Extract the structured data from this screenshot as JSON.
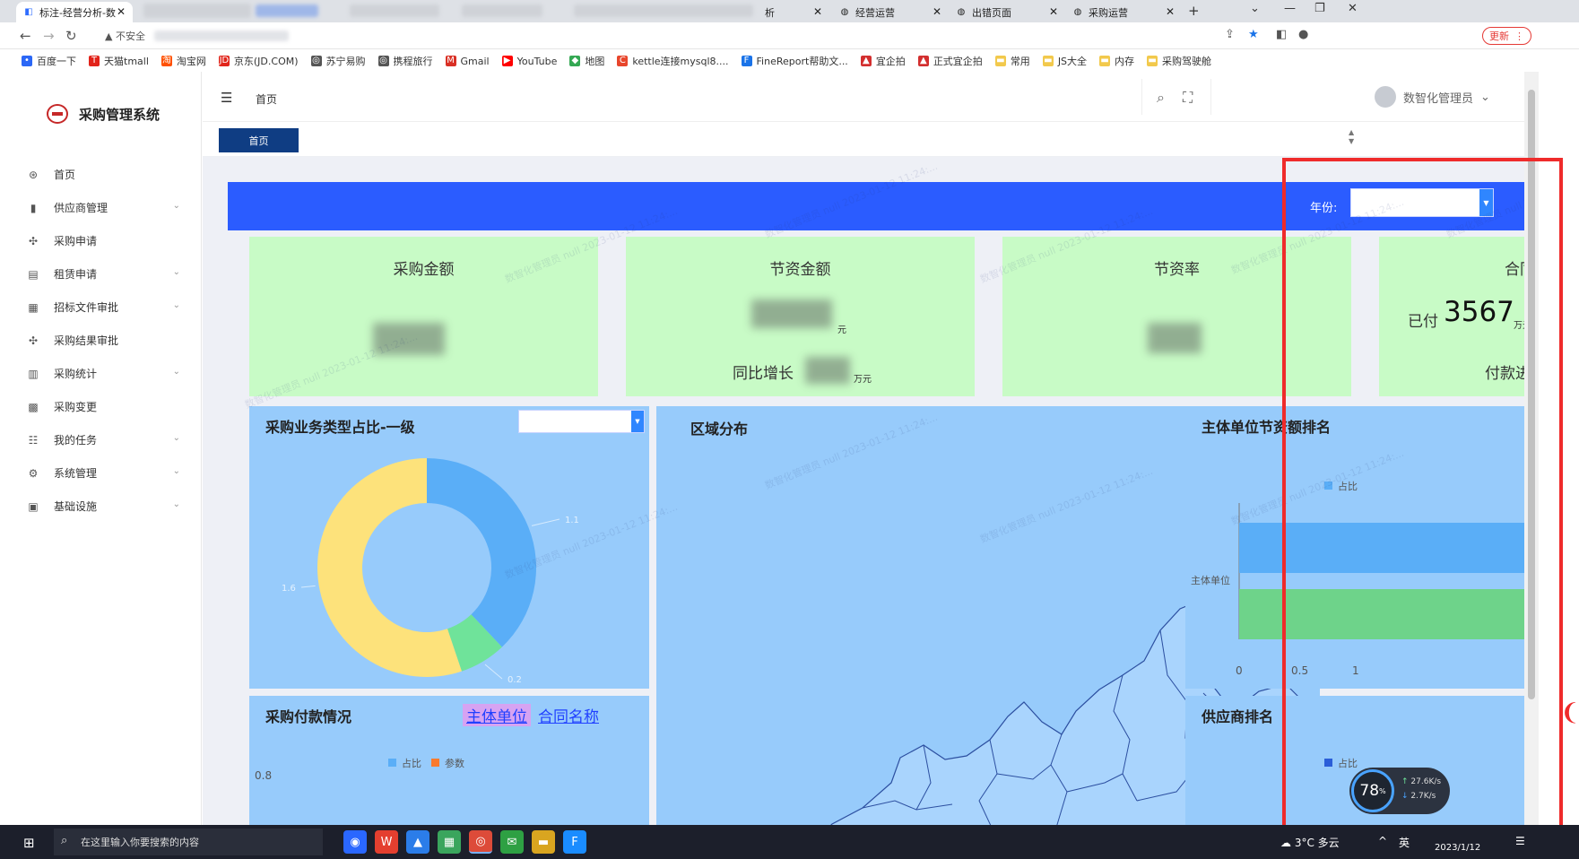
{
  "browser": {
    "tabs": [
      {
        "title": "标注-经营分析-数",
        "close": "✕"
      },
      {
        "title": "析",
        "close": "✕"
      },
      {
        "title": "经营运营",
        "close": "✕"
      },
      {
        "title": "出错页面",
        "close": "✕"
      },
      {
        "title": "采购运营",
        "close": "✕"
      }
    ],
    "new_tab": "+",
    "insecure_label": "不安全",
    "update_label": "更新",
    "bookmarks": [
      {
        "label": "百度一下",
        "color": "#2b67f6",
        "glyph": "•"
      },
      {
        "label": "天猫tmall",
        "color": "#e2231a",
        "glyph": "T"
      },
      {
        "label": "淘宝网",
        "color": "#ff5000",
        "glyph": "淘"
      },
      {
        "label": "京东(JD.COM)",
        "color": "#e1251b",
        "glyph": "JD"
      },
      {
        "label": "苏宁易购",
        "color": "#555555",
        "glyph": "◎"
      },
      {
        "label": "携程旅行",
        "color": "#555555",
        "glyph": "◎"
      },
      {
        "label": "Gmail",
        "color": "#d93025",
        "glyph": "M"
      },
      {
        "label": "YouTube",
        "color": "#ff0000",
        "glyph": "▶"
      },
      {
        "label": "地图",
        "color": "#34a853",
        "glyph": "◆"
      },
      {
        "label": "kettle连接mysql8....",
        "color": "#e8462c",
        "glyph": "C"
      },
      {
        "label": "FineReport帮助文...",
        "color": "#1a73e8",
        "glyph": "F"
      },
      {
        "label": "宜企拍",
        "color": "#d32f2f",
        "glyph": "▲"
      },
      {
        "label": "正式宜企拍",
        "color": "#d32f2f",
        "glyph": "▲"
      },
      {
        "label": "常用",
        "color": "#f2c94c",
        "glyph": "▬"
      },
      {
        "label": "JS大全",
        "color": "#f2c94c",
        "glyph": "▬"
      },
      {
        "label": "内存",
        "color": "#f2c94c",
        "glyph": "▬"
      },
      {
        "label": "采购驾驶舱",
        "color": "#f2c94c",
        "glyph": "▬"
      }
    ]
  },
  "app": {
    "name": "采购管理系统",
    "breadcrumb": "首页",
    "home_tag": "首页",
    "user_name": "数智化管理员",
    "menu": [
      {
        "label": "首页",
        "icon": "⊛",
        "has_children": false
      },
      {
        "label": "供应商管理",
        "icon": "▮",
        "has_children": true
      },
      {
        "label": "采购申请",
        "icon": "✣",
        "has_children": false
      },
      {
        "label": "租赁申请",
        "icon": "▤",
        "has_children": true
      },
      {
        "label": "招标文件审批",
        "icon": "▦",
        "has_children": true
      },
      {
        "label": "采购结果审批",
        "icon": "✣",
        "has_children": false
      },
      {
        "label": "采购统计",
        "icon": "▥",
        "has_children": true
      },
      {
        "label": "采购变更",
        "icon": "▩",
        "has_children": false
      },
      {
        "label": "我的任务",
        "icon": "☷",
        "has_children": true
      },
      {
        "label": "系统管理",
        "icon": "⚙",
        "has_children": true
      },
      {
        "label": "基础设施",
        "icon": "▣",
        "has_children": true
      }
    ]
  },
  "dashboard": {
    "year_label": "年份:",
    "kpis": [
      {
        "title": "采购金额"
      },
      {
        "title": "节资金额",
        "unit": "元",
        "sub_label": "同比增长",
        "sub_unit": "万元"
      },
      {
        "title": "节资率"
      },
      {
        "title": "合同",
        "paid_label": "已付",
        "paid_value": "3567",
        "paid_unit": "万元",
        "progress_label": "付款进"
      }
    ],
    "panels": {
      "type_ratio": {
        "title": "采购业务类型占比-一级"
      },
      "region": {
        "title": "区域分布"
      },
      "saving_rank": {
        "title": "主体单位节资额排名",
        "legend": "占比",
        "y_label": "主体单位",
        "x_ticks": [
          "0",
          "0.5",
          "1"
        ]
      },
      "payment": {
        "title": "采购付款情况",
        "tab_unit": "主体单位",
        "tab_contract": "合同名称",
        "legend_a": "占比",
        "legend_b": "参数",
        "y_tick": "0.8"
      },
      "supplier_rank": {
        "title": "供应商排名",
        "legend": "占比"
      }
    },
    "watermark": "数智化管理员 null 2023-01-12 11:24:..."
  },
  "chart_data": [
    {
      "type": "pie",
      "title": "采购业务类型占比-一级",
      "labels": [
        "",
        "",
        ""
      ],
      "values": [
        1.1,
        0.2,
        1.6
      ],
      "colors": [
        "#5aaef7",
        "#6fe39a",
        "#fde27b"
      ]
    },
    {
      "type": "bar",
      "title": "主体单位节资额排名",
      "orientation": "horizontal",
      "categories": [
        "主体单位"
      ],
      "series": [
        {
          "name": "占比",
          "values": [
            1
          ],
          "color": "#5aaef7"
        },
        {
          "name": "",
          "values": [
            1
          ],
          "color": "#6ed38a"
        }
      ],
      "xlim": [
        0,
        1
      ]
    }
  ],
  "sys": {
    "netmon_pct": "78",
    "netmon_pct_sign": "%",
    "up_rate": "27.6K/s",
    "down_rate": "2.7K/s",
    "search_placeholder": "在这里输入你要搜索的内容",
    "weather": "3°C 多云",
    "ime": "英",
    "date": "2023/1/12"
  }
}
